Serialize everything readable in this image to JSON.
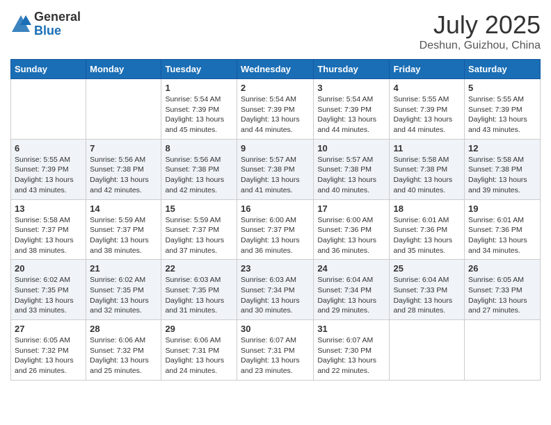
{
  "header": {
    "logo_general": "General",
    "logo_blue": "Blue",
    "month_title": "July 2025",
    "location": "Deshun, Guizhou, China"
  },
  "weekdays": [
    "Sunday",
    "Monday",
    "Tuesday",
    "Wednesday",
    "Thursday",
    "Friday",
    "Saturday"
  ],
  "weeks": [
    [
      {
        "day": "",
        "info": ""
      },
      {
        "day": "",
        "info": ""
      },
      {
        "day": "1",
        "info": "Sunrise: 5:54 AM\nSunset: 7:39 PM\nDaylight: 13 hours and 45 minutes."
      },
      {
        "day": "2",
        "info": "Sunrise: 5:54 AM\nSunset: 7:39 PM\nDaylight: 13 hours and 44 minutes."
      },
      {
        "day": "3",
        "info": "Sunrise: 5:54 AM\nSunset: 7:39 PM\nDaylight: 13 hours and 44 minutes."
      },
      {
        "day": "4",
        "info": "Sunrise: 5:55 AM\nSunset: 7:39 PM\nDaylight: 13 hours and 44 minutes."
      },
      {
        "day": "5",
        "info": "Sunrise: 5:55 AM\nSunset: 7:39 PM\nDaylight: 13 hours and 43 minutes."
      }
    ],
    [
      {
        "day": "6",
        "info": "Sunrise: 5:55 AM\nSunset: 7:39 PM\nDaylight: 13 hours and 43 minutes."
      },
      {
        "day": "7",
        "info": "Sunrise: 5:56 AM\nSunset: 7:38 PM\nDaylight: 13 hours and 42 minutes."
      },
      {
        "day": "8",
        "info": "Sunrise: 5:56 AM\nSunset: 7:38 PM\nDaylight: 13 hours and 42 minutes."
      },
      {
        "day": "9",
        "info": "Sunrise: 5:57 AM\nSunset: 7:38 PM\nDaylight: 13 hours and 41 minutes."
      },
      {
        "day": "10",
        "info": "Sunrise: 5:57 AM\nSunset: 7:38 PM\nDaylight: 13 hours and 40 minutes."
      },
      {
        "day": "11",
        "info": "Sunrise: 5:58 AM\nSunset: 7:38 PM\nDaylight: 13 hours and 40 minutes."
      },
      {
        "day": "12",
        "info": "Sunrise: 5:58 AM\nSunset: 7:38 PM\nDaylight: 13 hours and 39 minutes."
      }
    ],
    [
      {
        "day": "13",
        "info": "Sunrise: 5:58 AM\nSunset: 7:37 PM\nDaylight: 13 hours and 38 minutes."
      },
      {
        "day": "14",
        "info": "Sunrise: 5:59 AM\nSunset: 7:37 PM\nDaylight: 13 hours and 38 minutes."
      },
      {
        "day": "15",
        "info": "Sunrise: 5:59 AM\nSunset: 7:37 PM\nDaylight: 13 hours and 37 minutes."
      },
      {
        "day": "16",
        "info": "Sunrise: 6:00 AM\nSunset: 7:37 PM\nDaylight: 13 hours and 36 minutes."
      },
      {
        "day": "17",
        "info": "Sunrise: 6:00 AM\nSunset: 7:36 PM\nDaylight: 13 hours and 36 minutes."
      },
      {
        "day": "18",
        "info": "Sunrise: 6:01 AM\nSunset: 7:36 PM\nDaylight: 13 hours and 35 minutes."
      },
      {
        "day": "19",
        "info": "Sunrise: 6:01 AM\nSunset: 7:36 PM\nDaylight: 13 hours and 34 minutes."
      }
    ],
    [
      {
        "day": "20",
        "info": "Sunrise: 6:02 AM\nSunset: 7:35 PM\nDaylight: 13 hours and 33 minutes."
      },
      {
        "day": "21",
        "info": "Sunrise: 6:02 AM\nSunset: 7:35 PM\nDaylight: 13 hours and 32 minutes."
      },
      {
        "day": "22",
        "info": "Sunrise: 6:03 AM\nSunset: 7:35 PM\nDaylight: 13 hours and 31 minutes."
      },
      {
        "day": "23",
        "info": "Sunrise: 6:03 AM\nSunset: 7:34 PM\nDaylight: 13 hours and 30 minutes."
      },
      {
        "day": "24",
        "info": "Sunrise: 6:04 AM\nSunset: 7:34 PM\nDaylight: 13 hours and 29 minutes."
      },
      {
        "day": "25",
        "info": "Sunrise: 6:04 AM\nSunset: 7:33 PM\nDaylight: 13 hours and 28 minutes."
      },
      {
        "day": "26",
        "info": "Sunrise: 6:05 AM\nSunset: 7:33 PM\nDaylight: 13 hours and 27 minutes."
      }
    ],
    [
      {
        "day": "27",
        "info": "Sunrise: 6:05 AM\nSunset: 7:32 PM\nDaylight: 13 hours and 26 minutes."
      },
      {
        "day": "28",
        "info": "Sunrise: 6:06 AM\nSunset: 7:32 PM\nDaylight: 13 hours and 25 minutes."
      },
      {
        "day": "29",
        "info": "Sunrise: 6:06 AM\nSunset: 7:31 PM\nDaylight: 13 hours and 24 minutes."
      },
      {
        "day": "30",
        "info": "Sunrise: 6:07 AM\nSunset: 7:31 PM\nDaylight: 13 hours and 23 minutes."
      },
      {
        "day": "31",
        "info": "Sunrise: 6:07 AM\nSunset: 7:30 PM\nDaylight: 13 hours and 22 minutes."
      },
      {
        "day": "",
        "info": ""
      },
      {
        "day": "",
        "info": ""
      }
    ]
  ]
}
